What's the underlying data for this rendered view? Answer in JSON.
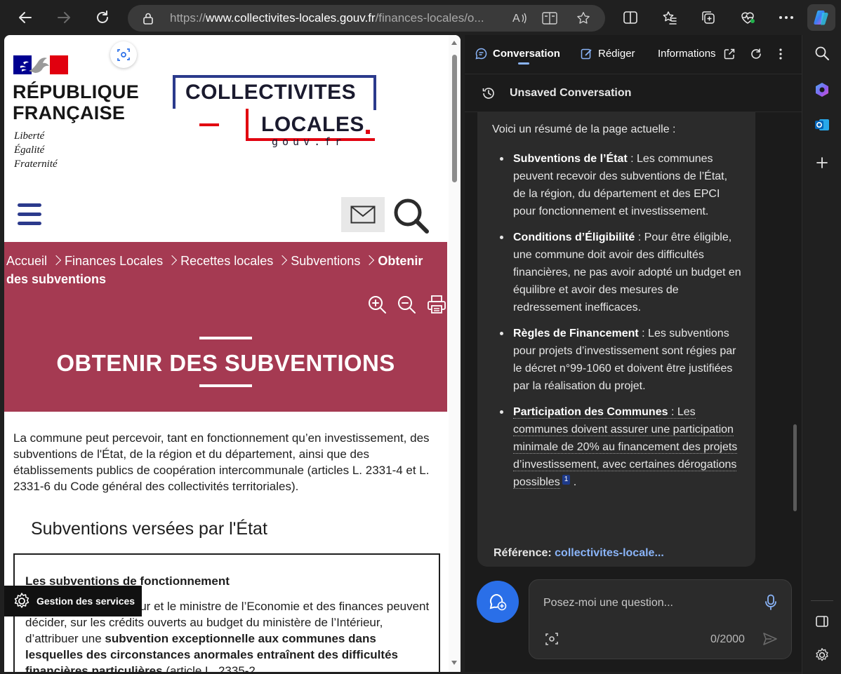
{
  "browser": {
    "url_prefix": "https://",
    "url_domain": "www.collectivites-locales.gouv.fr",
    "url_path": "/finances-locales/o..."
  },
  "site": {
    "rf_line1": "RÉPUBLIQUE",
    "rf_line2": "FRANÇAISE",
    "motto_1": "Liberté",
    "motto_2": "Égalité",
    "motto_3": "Fraternité",
    "logo_line1": "COLLECTIVITES",
    "logo_line2": "LOCALES",
    "logo_line3": "gouv.fr"
  },
  "breadcrumb": {
    "items": [
      "Accueil",
      "Finances Locales",
      "Recettes locales",
      "Subventions"
    ],
    "current": "Obtenir des subventions"
  },
  "hero": {
    "title": "OBTENIR DES SUBVENTIONS"
  },
  "content": {
    "intro": "La commune peut percevoir, tant en fonctionnement qu’en investissement, des subventions de l'État, de la région et du département, ainsi que des établissements publics de coopération intercommunale (articles L. 2331-4 et L. 2331-6 du Code général des collectivités territoriales).",
    "section_title": "Subventions versées par l'État",
    "box_title": "Les subventions de fonctionnement",
    "box_text_1": "ieur et le ministre de l’Economie et des finances peuvent décider, sur les crédits ouverts au budget du ministère de l’Intérieur, d’attribuer une ",
    "box_text_bold": "subvention exceptionnelle aux communes dans lesquelles des circonstances anormales entraînent des difficultés financières particulières",
    "box_text_2": " (article L. 2335-2"
  },
  "gestion": {
    "label": "Gestion des services"
  },
  "copilot": {
    "tabs": {
      "conversation": "Conversation",
      "rediger": "Rédiger",
      "informations": "Informations"
    },
    "session_title": "Unsaved Conversation",
    "intro": "Voici un résumé de la page actuelle :",
    "bullets": [
      {
        "title": "Subventions de l’État",
        "text": " : Les communes peuvent recevoir des subventions de l’État, de la région, du département et des EPCI pour fonctionnement et investissement."
      },
      {
        "title": "Conditions d’Éligibilité",
        "text": " : Pour être éligible, une commune doit avoir des difficultés financières, ne pas avoir adopté un budget en équilibre et avoir des mesures de redressement inefficaces."
      },
      {
        "title": "Règles de Financement",
        "text": " : Les subventions pour projets d’investissement sont régies par le décret n°99-1060 et doivent être justifiées par la réalisation du projet."
      },
      {
        "title": "Participation des Communes",
        "text": " : Les communes doivent assurer une participation minimale de 20% au financement des projets d’investissement, avec certaines dérogations possibles",
        "citation": "1"
      }
    ],
    "reference_label": "Référence:",
    "reference_link": "collectivites-locale...",
    "input_placeholder": "Posez-moi une question...",
    "char_counter": "0/2000"
  },
  "colors": {
    "hero_bg": "#a53a52",
    "brand_blue": "#2b3a8c",
    "brand_red": "#e1000f",
    "copilot_accent": "#2a6fe8",
    "link": "#8ab4f8"
  }
}
